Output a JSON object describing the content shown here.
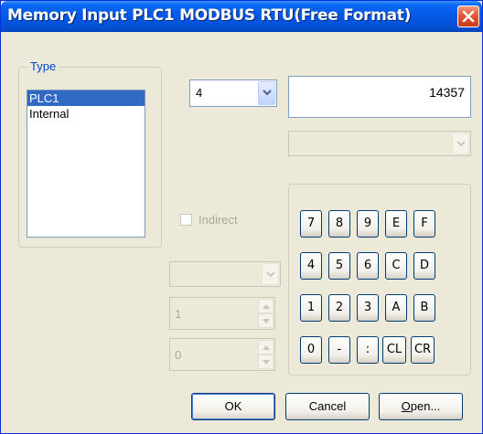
{
  "window": {
    "title": "Memory Input  PLC1 MODBUS RTU(Free Format)"
  },
  "type_group": {
    "label": "Type",
    "items": [
      {
        "label": "PLC1",
        "selected": true
      },
      {
        "label": "Internal",
        "selected": false
      }
    ]
  },
  "device_combo": {
    "value": "4"
  },
  "address_value": "14357",
  "sub_combo": {
    "value": ""
  },
  "indirect": {
    "label": "Indirect",
    "checked": false
  },
  "indirect_combo": {
    "value": ""
  },
  "spin1": {
    "value": "1"
  },
  "spin2": {
    "value": "0"
  },
  "keypad": {
    "keys": [
      "7",
      "8",
      "9",
      "E",
      "F",
      "4",
      "5",
      "6",
      "C",
      "D",
      "1",
      "2",
      "3",
      "A",
      "B",
      "0",
      "-",
      ":",
      "CL",
      "CR"
    ]
  },
  "buttons": {
    "ok": "OK",
    "cancel": "Cancel",
    "open_prefix": "O",
    "open_rest": "pen..."
  }
}
